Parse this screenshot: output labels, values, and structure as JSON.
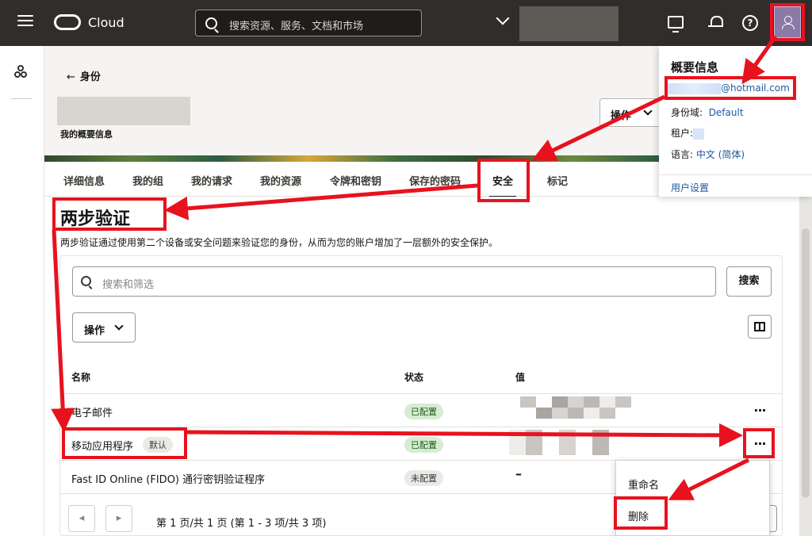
{
  "topbar": {
    "brand": "Cloud",
    "search_placeholder": "搜索资源、服务、文档和市场"
  },
  "header": {
    "back_label": "身份",
    "subtitle": "我的概要信息",
    "actions_label": "操作"
  },
  "tabs": [
    {
      "label": "详细信息"
    },
    {
      "label": "我的组"
    },
    {
      "label": "我的请求"
    },
    {
      "label": "我的资源"
    },
    {
      "label": "令牌和密钥"
    },
    {
      "label": "保存的密码"
    },
    {
      "label": "安全",
      "active": true
    },
    {
      "label": "标记"
    }
  ],
  "section": {
    "title": "两步验证",
    "description": "两步验证通过使用第二个设备或安全问题来验证您的身份，从而为您的账户增加了一层额外的安全保护。",
    "filter_placeholder": "搜索和筛选",
    "search_button": "搜索",
    "actions_button": "操作"
  },
  "table": {
    "columns": [
      "名称",
      "状态",
      "值"
    ],
    "rows": [
      {
        "name": "电子邮件",
        "status": "已配置",
        "value": ""
      },
      {
        "name": "移动应用程序",
        "tag": "默认",
        "status": "已配置",
        "value": ""
      },
      {
        "name": "Fast ID Online (FIDO) 通行密钥验证程序",
        "status": "未配置",
        "value": "–"
      }
    ],
    "kebab": "···"
  },
  "pagination": {
    "text": "第 1 页/共 1 页 (第 1 - 3 项/共 3 项)"
  },
  "row_menu": {
    "items": [
      "重命名",
      "删除"
    ]
  },
  "profile": {
    "title": "概要信息",
    "email_suffix": "@hotmail.com",
    "domain_label": "身份域:",
    "domain_value": "Default",
    "tenant_label": "租户:",
    "language_label": "语言:",
    "language_value": "中文 (简体)",
    "user_settings": "用户设置"
  },
  "colors": {
    "topbar": "#312d2a",
    "annotation_red": "#e8121e",
    "badge_configured": "#d7ecd3",
    "link": "#1d5aa1"
  },
  "icons": [
    "hamburger-icon",
    "oracle-logo-icon",
    "search-icon",
    "chevron-down-icon",
    "monitor-icon",
    "bell-icon",
    "help-icon",
    "user-icon",
    "nav-icon",
    "back-arrow-icon",
    "columns-icon",
    "kebab-icon",
    "chevron-left-icon",
    "chevron-right-icon"
  ]
}
